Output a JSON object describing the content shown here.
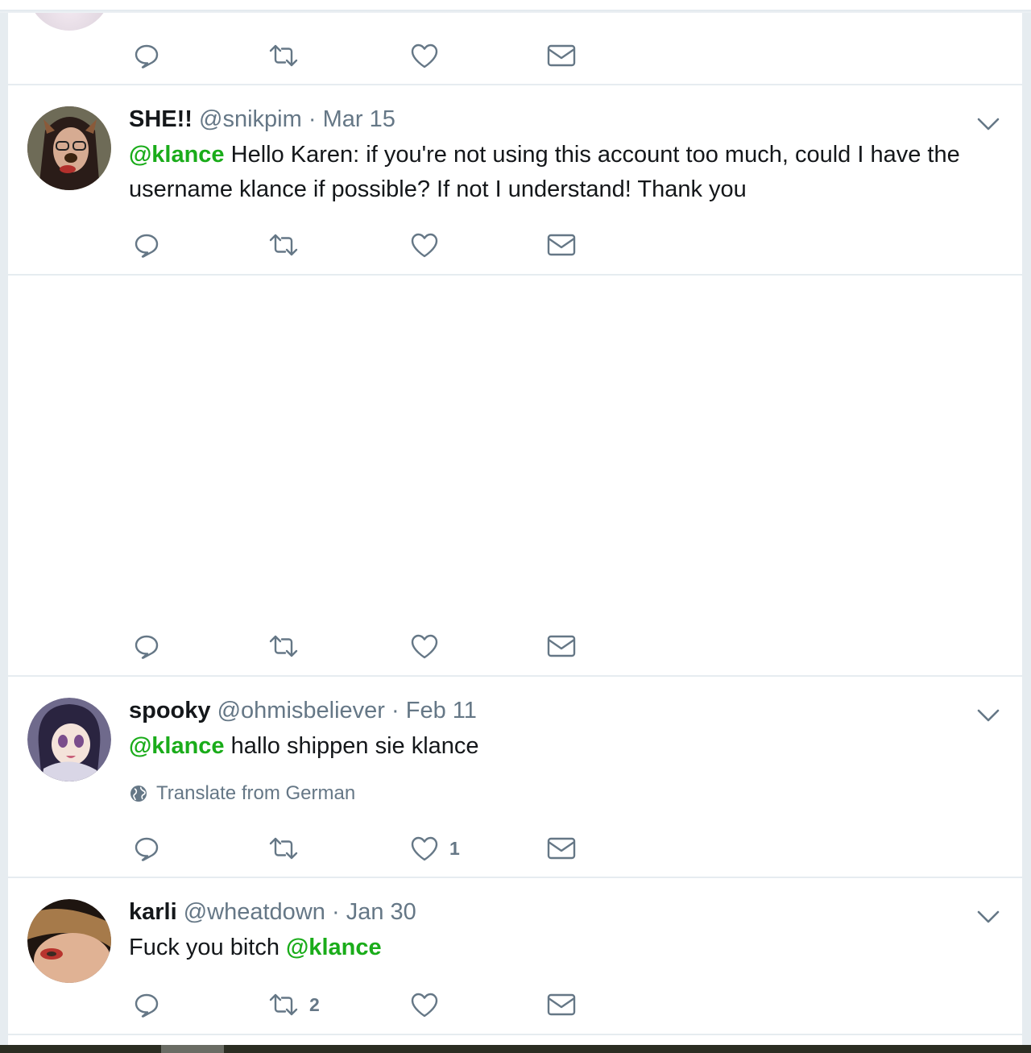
{
  "colors": {
    "mention": "#1aac1a",
    "muted": "#657786",
    "divider": "#e6ecf0"
  },
  "tweets": [
    {
      "id": "prev",
      "actions": {
        "reply": "",
        "retweet": "",
        "like": "",
        "dm": ""
      }
    },
    {
      "id": "snikpim",
      "fullname": "SHE!!",
      "handle": "@snikpim",
      "dot": "·",
      "time": "Mar 15",
      "mention": "@klance",
      "text": " Hello Karen: if you're not using this account too much, could I have the username klance if possible? If not I understand! Thank you",
      "actions": {
        "reply": "",
        "retweet": "",
        "like": "",
        "dm": ""
      }
    },
    {
      "id": "blank",
      "actions": {
        "reply": "",
        "retweet": "",
        "like": "",
        "dm": ""
      }
    },
    {
      "id": "ohmisbeliever",
      "fullname": "spooky",
      "handle": "@ohmisbeliever",
      "dot": "·",
      "time": "Feb 11",
      "mention": "@klance",
      "text": " hallo shippen sie klance",
      "translate": "Translate from German",
      "actions": {
        "reply": "",
        "retweet": "",
        "like": "1",
        "dm": ""
      }
    },
    {
      "id": "wheatdown",
      "fullname": "karli",
      "handle": "@wheatdown",
      "dot": "·",
      "time": "Jan 30",
      "text_before": "Fuck you bitch ",
      "mention": "@klance",
      "actions": {
        "reply": "",
        "retweet": "2",
        "like": "",
        "dm": ""
      }
    }
  ],
  "icons": [
    "reply-icon",
    "retweet-icon",
    "like-icon",
    "direct-message-icon",
    "caret-down-icon",
    "globe-icon"
  ]
}
